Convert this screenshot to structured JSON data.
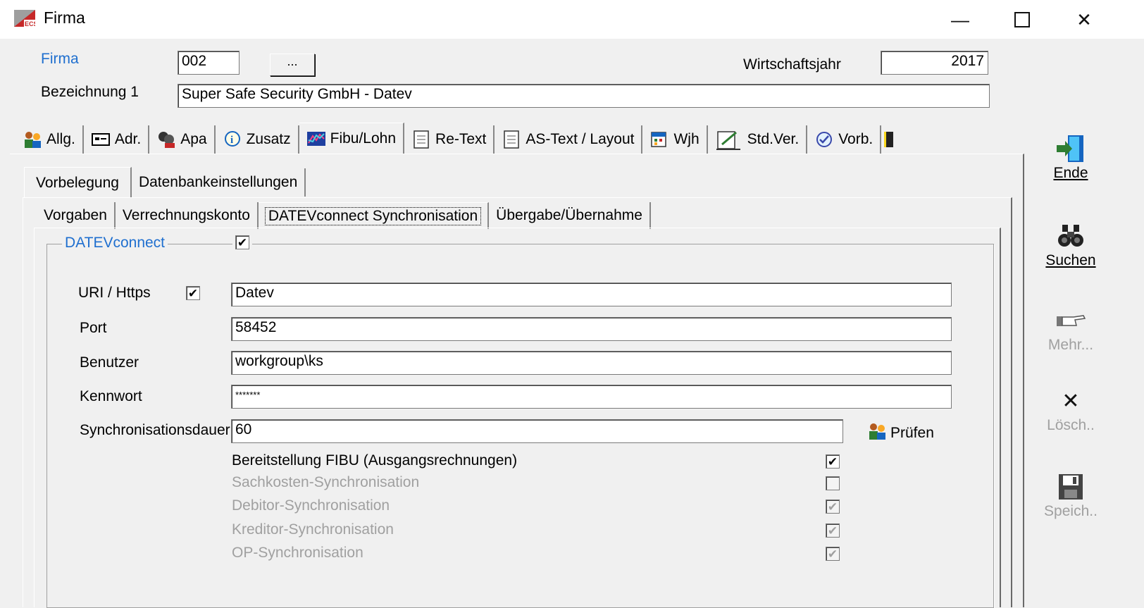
{
  "window": {
    "title": "Firma"
  },
  "header": {
    "firma_label": "Firma",
    "firma_value": "002",
    "browse_label": "...",
    "wj_label": "Wirtschaftsjahr",
    "wj_value": "2017",
    "bez_label": "Bezeichnung 1",
    "bez_value": "Super Safe Security GmbH - Datev"
  },
  "main_tabs": [
    {
      "label": "Allg.",
      "icon": "people-icon"
    },
    {
      "label": "Adr.",
      "icon": "card-icon"
    },
    {
      "label": "Apa",
      "icon": "contacts-icon"
    },
    {
      "label": "Zusatz",
      "icon": "info-icon"
    },
    {
      "label": "Fibu/Lohn",
      "icon": "chart-icon",
      "active": true
    },
    {
      "label": "Re-Text",
      "icon": "document-icon"
    },
    {
      "label": "AS-Text / Layout",
      "icon": "document-icon"
    },
    {
      "label": "Wjh",
      "icon": "calendar-icon"
    },
    {
      "label": "Std.Ver.",
      "icon": "edit-icon"
    },
    {
      "label": "Vorb.",
      "icon": "vorb-icon"
    }
  ],
  "sub_tabs": [
    "Vorbelegung",
    "Datenbankeinstellungen"
  ],
  "sub_sub_tabs": [
    "Vorgaben",
    "Verrechnungskonto",
    "DATEVconnect Synchronisation",
    "Übergabe/Übernahme"
  ],
  "datev": {
    "group_title": "DATEVconnect",
    "enabled_check": "✔",
    "uri_label": "URI / Https",
    "uri_check": "✔",
    "uri_value": "Datev",
    "port_label": "Port",
    "port_value": "58452",
    "user_label": "Benutzer",
    "user_value": "workgroup\\ks",
    "pass_label": "Kennwort",
    "pass_value": "*******",
    "sync_label": "Synchronisationsdauer",
    "sync_value": "60",
    "check_btn": "Prüfen",
    "options": [
      {
        "label": "Bereitstellung FIBU (Ausgangsrechnungen)",
        "mark": "✔",
        "enabled": true
      },
      {
        "label": "Sachkosten-Synchronisation",
        "mark": "",
        "enabled": false
      },
      {
        "label": "Debitor-Synchronisation",
        "mark": "✔",
        "enabled": false
      },
      {
        "label": "Kreditor-Synchronisation",
        "mark": "✔",
        "enabled": false
      },
      {
        "label": "OP-Synchronisation",
        "mark": "✔",
        "enabled": false
      }
    ]
  },
  "sidebar": {
    "ende": "Ende",
    "suchen": "Suchen",
    "mehr": "Mehr...",
    "loesch": "Lösch..",
    "speich": "Speich.."
  },
  "colors": {
    "accent_blue": "#1f6fcf",
    "disabled_gray": "#a0a0a0"
  }
}
